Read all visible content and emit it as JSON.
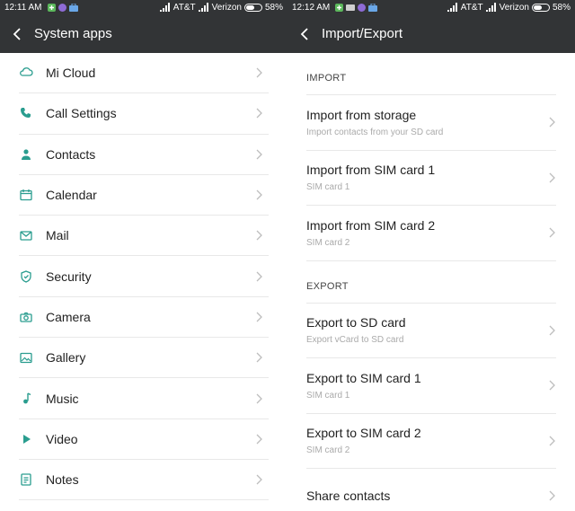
{
  "left": {
    "status": {
      "time": "12:11 AM",
      "carrier1": "AT&T",
      "carrier2": "Verizon",
      "battery": "58%"
    },
    "title": "System apps",
    "items": [
      {
        "label": "Mi Cloud",
        "icon": "cloud-icon"
      },
      {
        "label": "Call Settings",
        "icon": "phone-icon"
      },
      {
        "label": "Contacts",
        "icon": "person-icon"
      },
      {
        "label": "Calendar",
        "icon": "calendar-icon"
      },
      {
        "label": "Mail",
        "icon": "mail-icon"
      },
      {
        "label": "Security",
        "icon": "shield-icon"
      },
      {
        "label": "Camera",
        "icon": "camera-icon"
      },
      {
        "label": "Gallery",
        "icon": "gallery-icon"
      },
      {
        "label": "Music",
        "icon": "music-note-icon"
      },
      {
        "label": "Video",
        "icon": "play-icon"
      },
      {
        "label": "Notes",
        "icon": "notes-icon"
      }
    ]
  },
  "right": {
    "status": {
      "time": "12:12 AM",
      "carrier1": "AT&T",
      "carrier2": "Verizon",
      "battery": "58%"
    },
    "title": "Import/Export",
    "import_header": "IMPORT",
    "import_items": [
      {
        "label": "Import from storage",
        "sub": "Import contacts from your SD card"
      },
      {
        "label": "Import from SIM card 1",
        "sub": "SIM card 1"
      },
      {
        "label": "Import from SIM card 2",
        "sub": "SIM card 2"
      }
    ],
    "export_header": "EXPORT",
    "export_items": [
      {
        "label": "Export to SD card",
        "sub": "Export vCard to SD card"
      },
      {
        "label": "Export to SIM card 1",
        "sub": "SIM card 1"
      },
      {
        "label": "Export to SIM card 2",
        "sub": "SIM card 2"
      },
      {
        "label": "Share contacts",
        "sub": ""
      }
    ]
  },
  "colors": {
    "bar": "#323436",
    "accent": "#2a9d8f",
    "divider": "#e8e8e8"
  }
}
